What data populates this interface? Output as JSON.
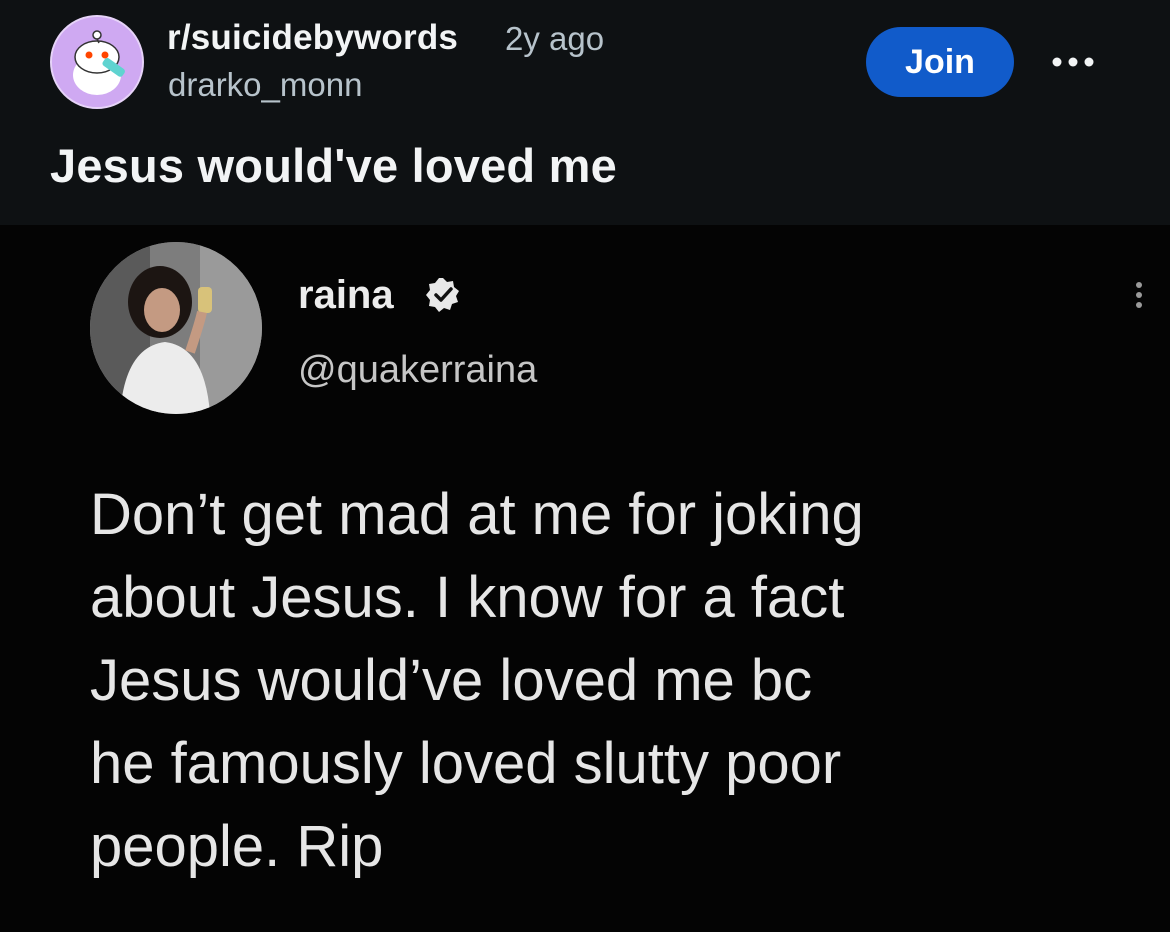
{
  "post": {
    "subreddit": "r/suicidebywords",
    "age": "2y ago",
    "author": "drarko_monn",
    "join_label": "Join",
    "title": "Jesus would've loved me"
  },
  "tweet": {
    "name": "raina",
    "handle": "@quakerraina",
    "lines": [
      "Don’t get mad at me for joking",
      "about Jesus. I know for a fact",
      "Jesus would’ve loved me bc",
      "he famously loved slutty poor",
      "people. Rip"
    ]
  },
  "icons": {
    "subreddit_avatar": "reddit-snoo-icon",
    "more": "more-horizontal-icon",
    "verified": "verified-badge-icon",
    "tweet_more": "more-vertical-icon"
  },
  "colors": {
    "background": "#0e1113",
    "join_button": "#115bca",
    "tweet_background": "#040404"
  }
}
